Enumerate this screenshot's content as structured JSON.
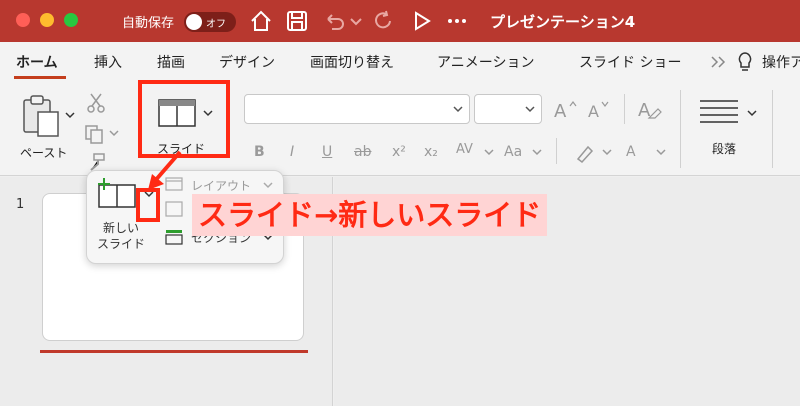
{
  "titlebar": {
    "autosave_label": "自動保存",
    "toggle_label": "オフ",
    "document_title": "プレゼンテーション4"
  },
  "tabs": [
    {
      "label": "ホーム",
      "active": true
    },
    {
      "label": "挿入"
    },
    {
      "label": "描画"
    },
    {
      "label": "デザイン"
    },
    {
      "label": "画面切り替え"
    },
    {
      "label": "アニメーション"
    },
    {
      "label": "スライド ショー"
    },
    {
      "label": "操作ア"
    }
  ],
  "ribbon": {
    "paste_label": "ペースト",
    "slide_label": "スライド",
    "paragraph_label": "段落",
    "format": {
      "bold": "B",
      "italic": "I",
      "underline": "U",
      "strikethrough": "ab",
      "superscript": "x²",
      "subscript": "x₂",
      "spacing": "AV",
      "case": "Aa",
      "font_color": "A"
    }
  },
  "popup": {
    "new_slide_label_line1": "新しい",
    "new_slide_label_line2": "スライド",
    "layout_label": "レイアウト",
    "section_label": "セクション"
  },
  "thumbnails": [
    {
      "number": "1"
    }
  ],
  "annotation": {
    "text": "スライド→新しいスライド",
    "color": "#ff2a14",
    "background": "#ffd4d4"
  },
  "colors": {
    "titlebar": "#b8382f",
    "accent": "#c43e1c"
  }
}
